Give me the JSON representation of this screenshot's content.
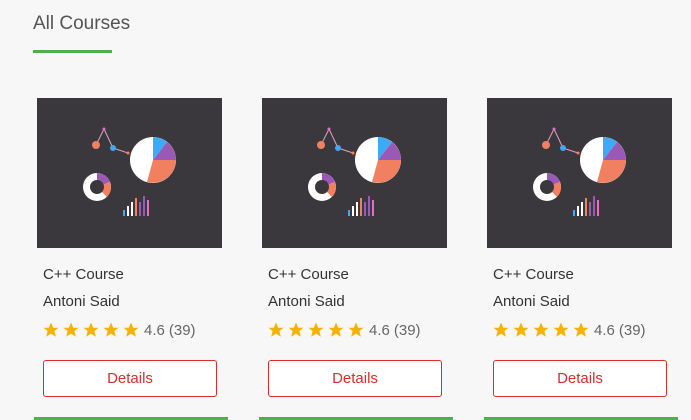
{
  "section": {
    "title": "All Courses",
    "accent_color": "#4caf50"
  },
  "courses": [
    {
      "title": "C++ Course",
      "instructor": "Antoni Said",
      "rating": "4.6",
      "rating_count": "(39)",
      "stars": 5,
      "details_label": "Details",
      "thumbnail_icon": "chart-illustration-icon"
    },
    {
      "title": "C++ Course",
      "instructor": "Antoni Said",
      "rating": "4.6",
      "rating_count": "(39)",
      "stars": 5,
      "details_label": "Details",
      "thumbnail_icon": "chart-illustration-icon"
    },
    {
      "title": "C++ Course",
      "instructor": "Antoni Said",
      "rating": "4.6",
      "rating_count": "(39)",
      "stars": 5,
      "details_label": "Details",
      "thumbnail_icon": "chart-illustration-icon"
    }
  ],
  "colors": {
    "star": "#f5b301",
    "button_text": "#d32f2f",
    "thumbnail_bg": "#3b383d"
  }
}
